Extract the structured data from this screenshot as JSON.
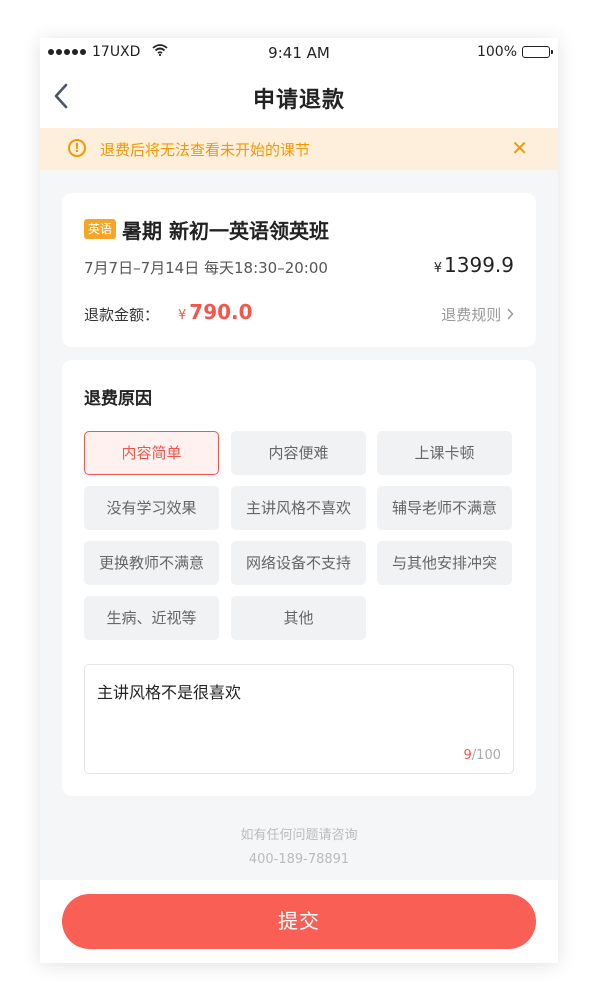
{
  "status_bar": {
    "carrier": "17UXD",
    "time": "9:41 AM",
    "battery": "100%"
  },
  "nav": {
    "title": "申请退款"
  },
  "notice": {
    "text": "退费后将无法查看未开始的课节"
  },
  "course": {
    "tag": "英语",
    "title": "暑期 新初一英语领英班",
    "schedule": "7月7日–7月14日 每天18:30–20:00",
    "price_symbol": "¥",
    "price": "1399.9",
    "refund_label": "退款金额：",
    "refund_symbol": "¥",
    "refund_amount": "790.0",
    "rules_label": "退费规则"
  },
  "reasons": {
    "title": "退费原因",
    "options": [
      {
        "label": "内容简单",
        "selected": true
      },
      {
        "label": "内容便难",
        "selected": false
      },
      {
        "label": "上课卡顿",
        "selected": false
      },
      {
        "label": "没有学习效果",
        "selected": false
      },
      {
        "label": "主讲风格不喜欢",
        "selected": false
      },
      {
        "label": "辅导老师不满意",
        "selected": false
      },
      {
        "label": "更换教师不满意",
        "selected": false
      },
      {
        "label": "网络设备不支持",
        "selected": false
      },
      {
        "label": "与其他安排冲突",
        "selected": false
      },
      {
        "label": "生病、近视等",
        "selected": false
      },
      {
        "label": "其他",
        "selected": false
      }
    ],
    "comment": "主讲风格不是很喜欢",
    "count_current": "9",
    "count_max": "/100"
  },
  "contact": {
    "line1": "如有任何问题请咨询",
    "phone": "400-189-78891"
  },
  "submit_label": "提交",
  "colors": {
    "accent": "#fa5f55",
    "warning": "#f39800",
    "tag": "#f6a623"
  },
  "icons": {
    "back": "chevron-left-icon",
    "notice": "warning-icon",
    "close": "close-icon",
    "rules": "chevron-right-icon"
  }
}
